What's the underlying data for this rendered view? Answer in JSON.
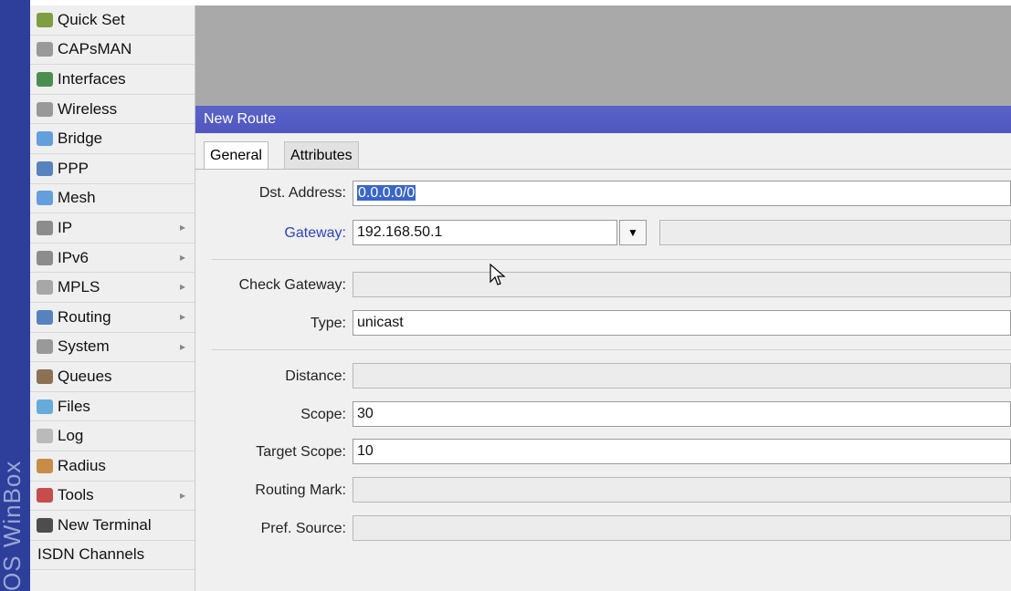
{
  "brand": "OS WinBox",
  "menu": [
    {
      "label": "Quick Set",
      "icon": "wand-icon",
      "color": "#6b8e23",
      "has_submenu": false
    },
    {
      "label": "CAPsMAN",
      "icon": "antenna-icon",
      "color": "#8a8a8a",
      "has_submenu": false
    },
    {
      "label": "Interfaces",
      "icon": "interfaces-icon",
      "color": "#2e7d32",
      "has_submenu": false
    },
    {
      "label": "Wireless",
      "icon": "antenna-icon",
      "color": "#8a8a8a",
      "has_submenu": false
    },
    {
      "label": "Bridge",
      "icon": "bridge-icon",
      "color": "#4a90d9",
      "has_submenu": false
    },
    {
      "label": "PPP",
      "icon": "ppp-icon",
      "color": "#3b6fb6",
      "has_submenu": false
    },
    {
      "label": "Mesh",
      "icon": "mesh-icon",
      "color": "#4a90d9",
      "has_submenu": false
    },
    {
      "label": "IP",
      "icon": "ip-icon",
      "color": "#7a7a7a",
      "has_submenu": true
    },
    {
      "label": "IPv6",
      "icon": "ipv6-icon",
      "color": "#7a7a7a",
      "has_submenu": true
    },
    {
      "label": "MPLS",
      "icon": "mpls-icon",
      "color": "#9a9a9a",
      "has_submenu": true
    },
    {
      "label": "Routing",
      "icon": "routing-icon",
      "color": "#3b6fb6",
      "has_submenu": true
    },
    {
      "label": "System",
      "icon": "gear-icon",
      "color": "#8a8a8a",
      "has_submenu": true
    },
    {
      "label": "Queues",
      "icon": "queues-icon",
      "color": "#7a5a3a",
      "has_submenu": false
    },
    {
      "label": "Files",
      "icon": "folder-icon",
      "color": "#4f9fd6",
      "has_submenu": false
    },
    {
      "label": "Log",
      "icon": "log-icon",
      "color": "#b0b0b0",
      "has_submenu": false
    },
    {
      "label": "Radius",
      "icon": "radius-icon",
      "color": "#c07a2a",
      "has_submenu": false
    },
    {
      "label": "Tools",
      "icon": "tools-icon",
      "color": "#c03030",
      "has_submenu": true
    },
    {
      "label": "New Terminal",
      "icon": "terminal-icon",
      "color": "#303030",
      "has_submenu": false
    },
    {
      "label": "ISDN Channels",
      "icon": "",
      "color": "",
      "has_submenu": false
    }
  ],
  "window": {
    "title": "New Route",
    "tabs": [
      "General",
      "Attributes"
    ],
    "fields": {
      "dst_address": {
        "label": "Dst. Address:",
        "value": "0.0.0.0/0"
      },
      "gateway": {
        "label": "Gateway:",
        "value": "192.168.50.1"
      },
      "check_gateway": {
        "label": "Check Gateway:",
        "value": ""
      },
      "type": {
        "label": "Type:",
        "value": "unicast"
      },
      "distance": {
        "label": "Distance:",
        "value": ""
      },
      "scope": {
        "label": "Scope:",
        "value": "30"
      },
      "target_scope": {
        "label": "Target Scope:",
        "value": "10"
      },
      "routing_mark": {
        "label": "Routing Mark:",
        "value": ""
      },
      "pref_source": {
        "label": "Pref. Source:",
        "value": ""
      }
    }
  },
  "colors": {
    "titlebar": "#4f57c0",
    "brand_strip": "#2d3f9a",
    "gateway_label": "#3044b8"
  }
}
